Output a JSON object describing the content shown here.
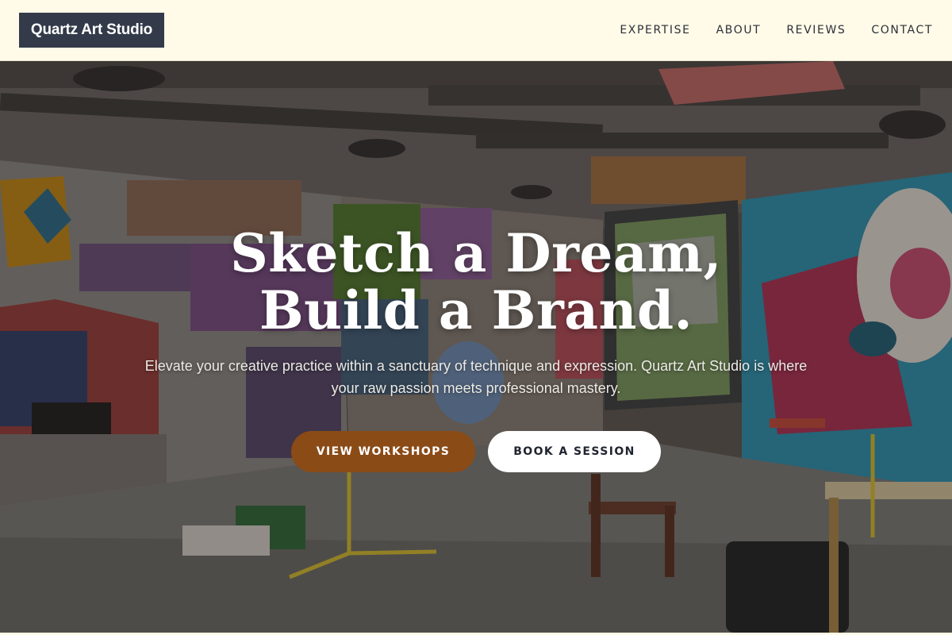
{
  "header": {
    "brand": "Quartz Art Studio",
    "nav": [
      "EXPERTISE",
      "ABOUT",
      "REVIEWS",
      "CONTACT"
    ]
  },
  "hero": {
    "headline_line1": "Sketch a Dream,",
    "headline_line2": "Build a Brand.",
    "subtext": "Elevate your creative practice within a sanctuary of technique and expression. Quartz Art Studio is where your raw passion meets professional mastery.",
    "primary_button": "VIEW WORKSHOPS",
    "secondary_button": "BOOK A SESSION",
    "background_image": "graffiti-art-studio-photo"
  },
  "colors": {
    "header_bg": "#fffbe8",
    "logo_bg": "#333b4a",
    "primary_button": "#8a4b17",
    "secondary_button": "#ffffff"
  }
}
